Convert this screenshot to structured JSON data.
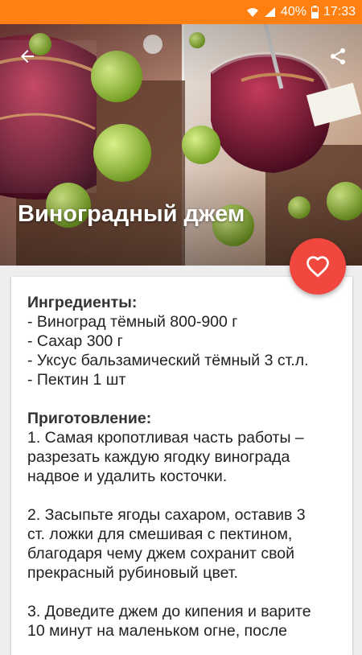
{
  "status_bar": {
    "battery": "40%",
    "time": "17:33",
    "color": "#ff7f10",
    "icons": [
      "wifi-icon",
      "signal-icon",
      "battery-icon"
    ]
  },
  "toolbar": {
    "back_icon": "arrow-left-icon",
    "share_icon": "share-icon"
  },
  "recipe": {
    "title": "Виноградный джем",
    "ingredients_heading": "Ингредиенты:",
    "ingredients": [
      "- Виноград тёмный 800-900 г",
      "- Сахар 300 г",
      "- Уксус бальзамический тёмный 3 ст.л.",
      "- Пектин 1 шт"
    ],
    "method_heading": "Приготовление:",
    "step1": [
      "1. Самая кропотливая часть работы –",
      "разрезать каждую ягодку винограда",
      "надвое и удалить косточки."
    ],
    "step2": [
      "2. Засыпьте ягоды сахаром, оставив 3",
      "ст. ложки для смешивая с пектином,",
      "благодаря чему джем сохранит свой",
      "прекрасный рубиновый цвет."
    ],
    "step3": [
      "3. Доведите джем до кипения и варите",
      "10 минут на маленьком огне, после"
    ]
  },
  "favorite": {
    "icon": "heart-icon",
    "color": "#f0483e"
  }
}
